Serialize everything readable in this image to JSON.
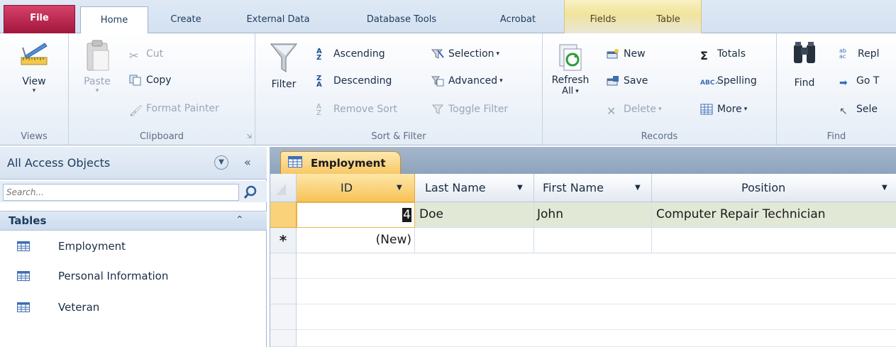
{
  "ribbon_tabs": {
    "file": "File",
    "home": "Home",
    "create": "Create",
    "external_data": "External Data",
    "database_tools": "Database Tools",
    "acrobat": "Acrobat",
    "fields": "Fields",
    "table": "Table"
  },
  "groups": {
    "views": {
      "label": "Views",
      "view": "View"
    },
    "clipboard": {
      "label": "Clipboard",
      "paste": "Paste",
      "cut": "Cut",
      "copy": "Copy",
      "format_painter": "Format Painter"
    },
    "sort_filter": {
      "label": "Sort & Filter",
      "filter": "Filter",
      "ascending": "Ascending",
      "descending": "Descending",
      "remove_sort": "Remove Sort",
      "selection": "Selection",
      "advanced": "Advanced",
      "toggle_filter": "Toggle Filter"
    },
    "records": {
      "label": "Records",
      "refresh_line1": "Refresh",
      "refresh_line2": "All",
      "new": "New",
      "save": "Save",
      "delete": "Delete",
      "totals": "Totals",
      "spelling": "Spelling",
      "more": "More"
    },
    "find": {
      "label": "Find",
      "find": "Find",
      "replace": "Repl",
      "goto": "Go T",
      "select": "Sele"
    }
  },
  "nav": {
    "title": "All Access Objects",
    "search_placeholder": "Search...",
    "section": "Tables",
    "items": [
      "Employment",
      "Personal Information",
      "Veteran"
    ]
  },
  "document": {
    "tab_title": "Employment",
    "columns": [
      "ID",
      "Last Name",
      "First Name",
      "Position"
    ],
    "rows": [
      {
        "id": "4",
        "last_name": "Doe",
        "first_name": "John",
        "position": "Computer Repair Technician"
      }
    ],
    "new_row_marker": "*",
    "new_row_label": "(New)"
  },
  "colors": {
    "file_tab": "#b21e46",
    "active_header": "#f7c257",
    "contextual_tabs": "#f1e49c"
  },
  "icons": [
    "view-icon",
    "paste-icon",
    "cut-icon",
    "copy-icon",
    "format-painter-icon",
    "filter-icon",
    "ascending-icon",
    "descending-icon",
    "remove-sort-icon",
    "selection-icon",
    "advanced-icon",
    "toggle-filter-icon",
    "refresh-icon",
    "new-record-icon",
    "save-record-icon",
    "delete-icon",
    "totals-icon",
    "spelling-icon",
    "more-icon",
    "binoculars-icon",
    "replace-icon",
    "goto-icon",
    "select-icon",
    "search-icon",
    "table-icon"
  ]
}
